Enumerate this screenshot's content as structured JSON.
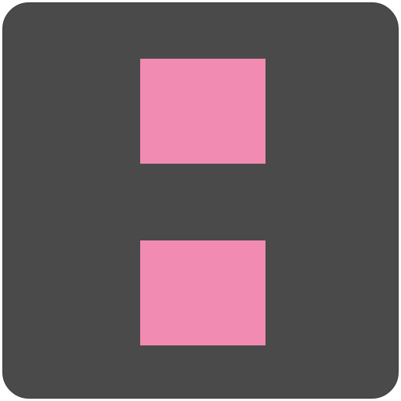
{
  "icon": {
    "name": "two-pink-squares-icon",
    "background_color": "#4a4a4a",
    "square_color": "#f28bb2",
    "square_count": 2
  }
}
